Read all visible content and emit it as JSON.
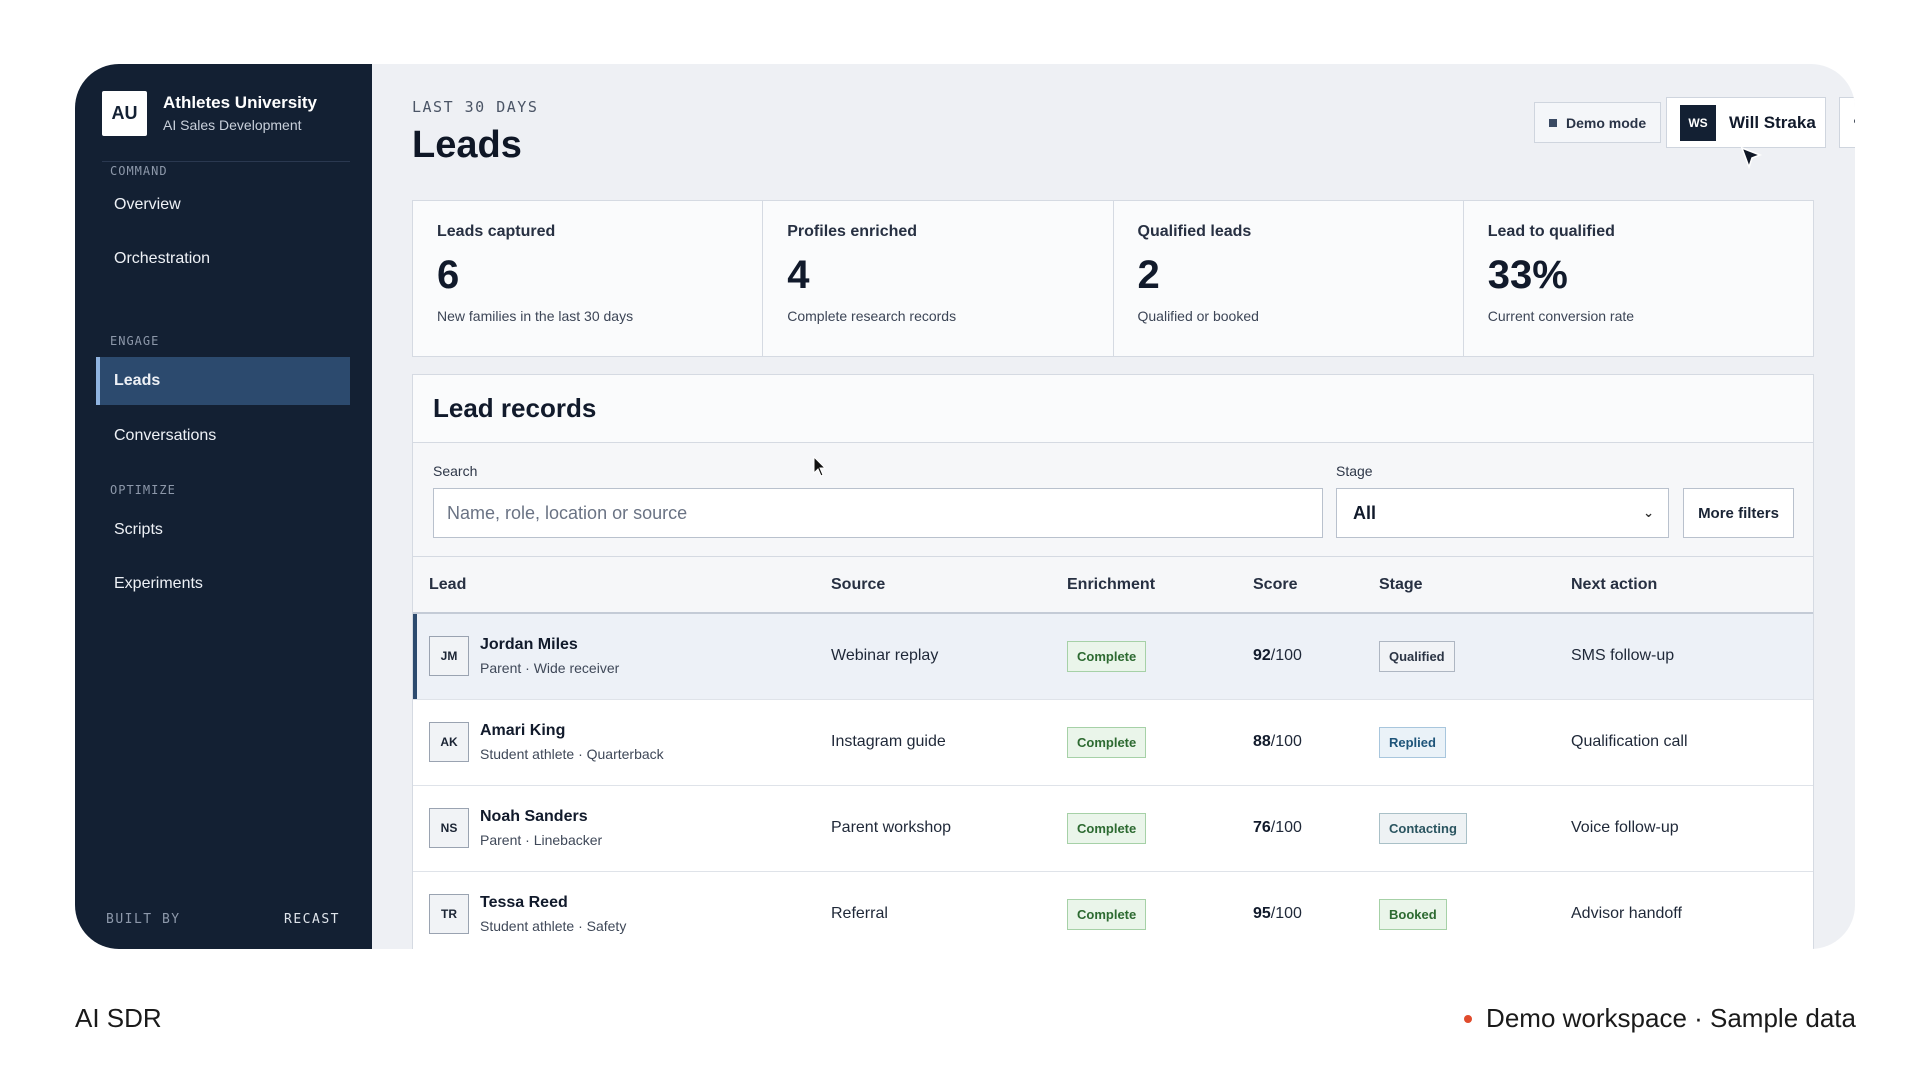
{
  "brand": {
    "logo": "AU",
    "name": "Athletes University",
    "subtitle": "AI Sales Development"
  },
  "sidebar": {
    "sections": [
      {
        "label": "COMMAND",
        "items": [
          "Overview",
          "Orchestration"
        ]
      },
      {
        "label": "ENGAGE",
        "items": [
          "Leads",
          "Conversations"
        ]
      },
      {
        "label": "OPTIMIZE",
        "items": [
          "Scripts",
          "Experiments"
        ]
      }
    ],
    "active_item": "Leads",
    "footer_left": "BUILT BY",
    "footer_right": "RECAST"
  },
  "header": {
    "eyebrow": "LAST 30 DAYS",
    "title": "Leads",
    "demo_mode_label": "Demo mode",
    "user_initials": "WS",
    "user_name": "Will Straka",
    "more_icon": "more-horizontal-icon"
  },
  "stats": [
    {
      "label": "Leads captured",
      "value": "6",
      "sub": "New families in the last 30 days"
    },
    {
      "label": "Profiles enriched",
      "value": "4",
      "sub": "Complete research records"
    },
    {
      "label": "Qualified leads",
      "value": "2",
      "sub": "Qualified or booked"
    },
    {
      "label": "Lead to qualified",
      "value": "33%",
      "sub": "Current conversion rate"
    }
  ],
  "records": {
    "title": "Lead records",
    "search_label": "Search",
    "search_placeholder": "Name, role, location or source",
    "stage_label": "Stage",
    "stage_value": "All",
    "more_filters_label": "More filters",
    "columns": [
      "Lead",
      "Source",
      "Enrichment",
      "Score",
      "Stage",
      "Next action"
    ],
    "rows": [
      {
        "initials": "JM",
        "name": "Jordan Miles",
        "meta": "Parent · Wide receiver",
        "source": "Webinar replay",
        "enrichment": "Complete",
        "score": "92",
        "score_suffix": "/100",
        "stage": "Qualified",
        "next_action": "SMS follow-up"
      },
      {
        "initials": "AK",
        "name": "Amari King",
        "meta": "Student athlete · Quarterback",
        "source": "Instagram guide",
        "enrichment": "Complete",
        "score": "88",
        "score_suffix": "/100",
        "stage": "Replied",
        "next_action": "Qualification call"
      },
      {
        "initials": "NS",
        "name": "Noah Sanders",
        "meta": "Parent · Linebacker",
        "source": "Parent workshop",
        "enrichment": "Complete",
        "score": "76",
        "score_suffix": "/100",
        "stage": "Contacting",
        "next_action": "Voice follow-up"
      },
      {
        "initials": "TR",
        "name": "Tessa Reed",
        "meta": "Student athlete · Safety",
        "source": "Referral",
        "enrichment": "Complete",
        "score": "95",
        "score_suffix": "/100",
        "stage": "Booked",
        "next_action": "Advisor handoff"
      }
    ]
  },
  "page_footer": {
    "left": "AI SDR",
    "right": "Demo workspace · Sample data"
  },
  "colors": {
    "sidebar_bg": "#132033",
    "active_nav": "#2c4a6e",
    "accent_dot": "#e04b2c"
  }
}
